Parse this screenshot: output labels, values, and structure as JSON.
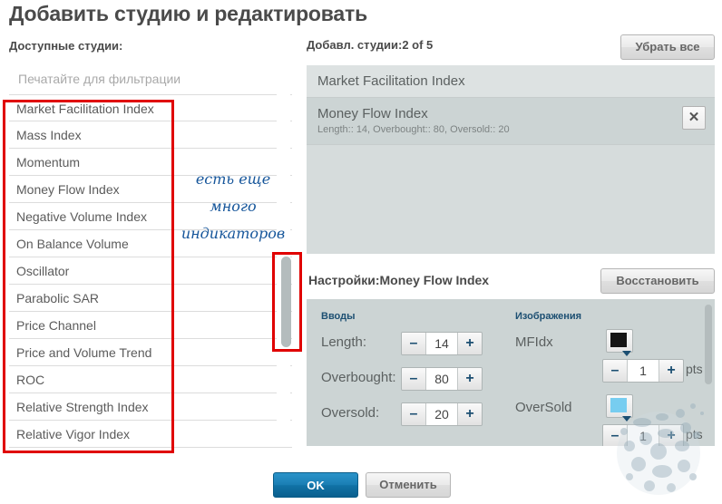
{
  "dialog": {
    "title": "Добавить студию и редактировать"
  },
  "left": {
    "available_label": "Доступные студии:",
    "filter_placeholder": "Печатайте для фильтрации",
    "filter_value": "",
    "studies": [
      "Market Facilitation Index",
      "Mass Index",
      "Momentum",
      "Money Flow Index",
      "Negative Volume Index",
      "On Balance Volume",
      "Oscillator",
      "Parabolic SAR",
      "Price Channel",
      "Price and Volume Trend",
      "ROC",
      "Relative Strength Index",
      "Relative Vigor Index"
    ]
  },
  "annotations": {
    "note_line1": "есть еще",
    "note_line2": "много",
    "note_line3": "индикаторов",
    "note_color": "#15559a",
    "box_color": "#e00000"
  },
  "right": {
    "added_label": "Добавл. студии:2 of 5",
    "remove_all_label": "Убрать все",
    "added_items": [
      {
        "title": "Market Facilitation Index",
        "sub": "",
        "selected": false,
        "has_close": false
      },
      {
        "title": "Money Flow Index",
        "sub": "Length:: 14, Overbought:: 80, Oversold:: 20",
        "selected": true,
        "has_close": true
      }
    ],
    "close_icon": "✕"
  },
  "settings": {
    "title": "Настройки:Money Flow Index",
    "restore_label": "Восстановить",
    "inputs_heading": "Вводы",
    "plots_heading": "Изображения",
    "inputs": [
      {
        "label": "Length:",
        "value": "14"
      },
      {
        "label": "Overbought:",
        "value": "80"
      },
      {
        "label": "Oversold:",
        "value": "20"
      }
    ],
    "plots": [
      {
        "label": "MFIdx",
        "color": "#151515",
        "width": "1",
        "units": "pts"
      },
      {
        "label": "OverSold",
        "color": "#77cdf0",
        "width": "1",
        "units": "pts"
      }
    ],
    "minus_glyph": "–",
    "plus_glyph": "+"
  },
  "footer": {
    "ok_label": "OK",
    "cancel_label": "Отменить"
  }
}
